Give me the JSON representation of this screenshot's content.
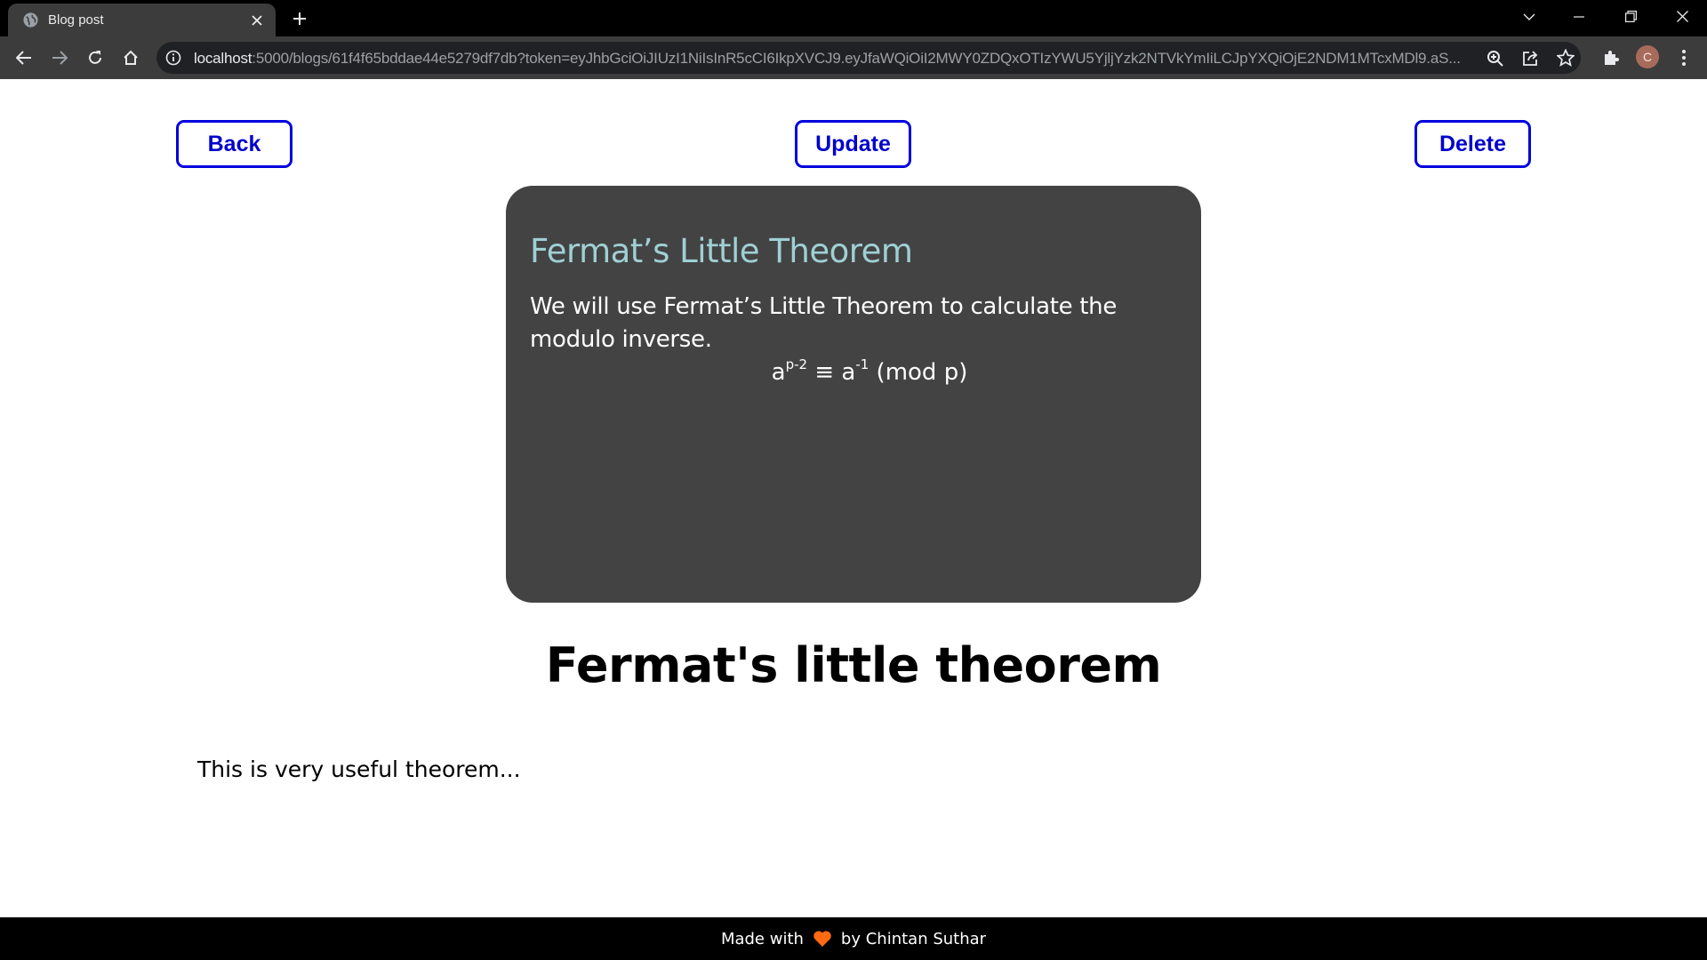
{
  "browser": {
    "tab_title": "Blog post",
    "url_host": "localhost",
    "url_rest": ":5000/blogs/61f4f65bddae44e5279df7db?token=eyJhbGciOiJIUzI1NiIsInR5cCI6IkpXVCJ9.eyJfaWQiOiI2MWY0ZDQxOTIzYWU5YjljYzk2NTVkYmIiLCJpYXQiOjE2NDM1MTcxMDl9.aS...",
    "profile_initial": "C",
    "icons": {
      "favicon": "globe-icon",
      "close_tab": "close-icon",
      "new_tab": "plus-icon",
      "back": "arrow-left-icon",
      "forward": "arrow-right-icon",
      "reload": "reload-icon",
      "home": "home-icon",
      "site_info": "info-icon",
      "zoom": "zoom-icon",
      "share": "share-icon",
      "bookmark": "star-icon",
      "extensions": "puzzle-icon",
      "menu": "kebab-menu-icon"
    }
  },
  "actions": {
    "back_label": "Back",
    "update_label": "Update",
    "delete_label": "Delete"
  },
  "post": {
    "image": {
      "heading": "Fermat’s Little Theorem",
      "body": "We will use Fermat’s Little Theorem to calculate the modulo inverse.",
      "formula": {
        "base1": "a",
        "exp1": "p-2",
        "middle": " ≡ a",
        "exp2": "-1",
        "tail": " (mod p)"
      }
    },
    "title": "Fermat's little theorem",
    "body": "This is very useful theorem..."
  },
  "footer": {
    "prefix": "Made with",
    "suffix": "by Chintan Suthar",
    "heart_color": "#ff6a13"
  },
  "colors": {
    "button_accent": "#0000dd",
    "slide_bg": "#434343",
    "slide_title": "#9fd0d4"
  }
}
